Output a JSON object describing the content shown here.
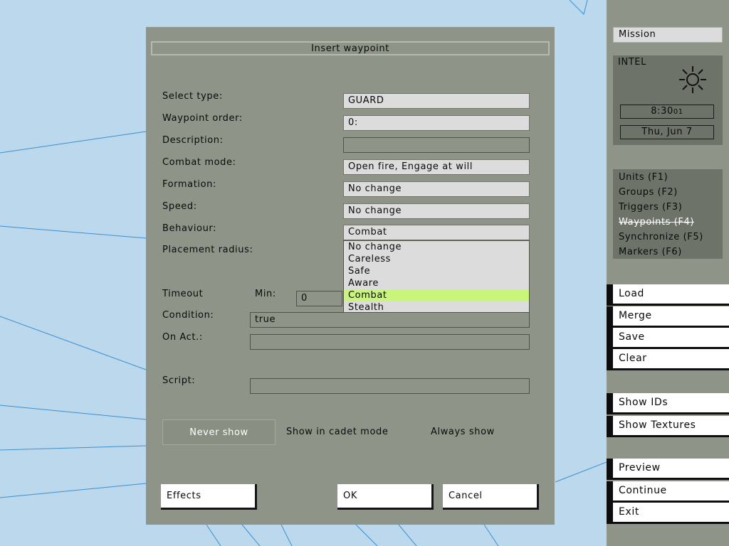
{
  "dialog": {
    "title": "Insert waypoint",
    "labels": {
      "type": "Select type:",
      "order": "Waypoint order:",
      "description": "Description:",
      "combat": "Combat mode:",
      "formation": "Formation:",
      "speed": "Speed:",
      "behaviour": "Behaviour:",
      "radius": "Placement radius:",
      "timeout": "Timeout",
      "min": "Min:",
      "condition": "Condition:",
      "onact": "On Act.:",
      "script": "Script:"
    },
    "values": {
      "type": "GUARD",
      "order": "0:",
      "description": "",
      "combat": "Open fire, Engage at will",
      "formation": "No change",
      "speed": "No change",
      "behaviour": "Combat",
      "min": "0",
      "condition": "true",
      "onact": "",
      "script": ""
    },
    "behaviour_options": [
      "No change",
      "Careless",
      "Safe",
      "Aware",
      "Combat",
      "Stealth"
    ],
    "behaviour_selected": "Combat",
    "show_modes": [
      "Never show",
      "Show in cadet mode",
      "Always show"
    ],
    "buttons": {
      "effects": "Effects",
      "ok": "OK",
      "cancel": "Cancel"
    }
  },
  "panel": {
    "mission": "Mission",
    "intel": {
      "label": "INTEL",
      "time": "8:30",
      "time_seconds": "01",
      "date": "Thu, Jun 7"
    },
    "modes": [
      "Units (F1)",
      "Groups (F2)",
      "Triggers (F3)",
      "Waypoints (F4)",
      "Synchronize (F5)",
      "Markers (F6)"
    ],
    "actions": [
      "Load",
      "Merge",
      "Save",
      "Clear"
    ],
    "view": [
      "Show IDs",
      "Show Textures"
    ],
    "run": [
      "Preview",
      "Continue",
      "Exit"
    ]
  },
  "colors": {
    "map": "#bcd8ec",
    "dialog": "#8f9488",
    "highlight": "#c9f57b"
  }
}
